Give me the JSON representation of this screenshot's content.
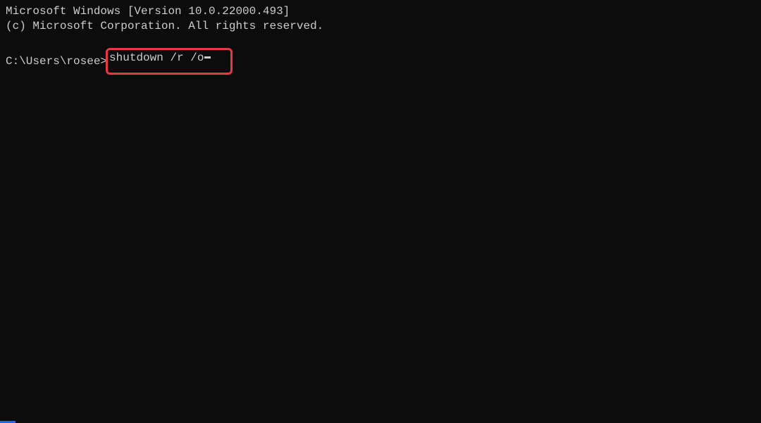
{
  "header": {
    "line1": "Microsoft Windows [Version 10.0.22000.493]",
    "line2": "(c) Microsoft Corporation. All rights reserved."
  },
  "prompt": {
    "path": "C:\\Users\\rosee>",
    "command": "shutdown /r /o"
  },
  "highlight": {
    "color": "#e63946"
  }
}
